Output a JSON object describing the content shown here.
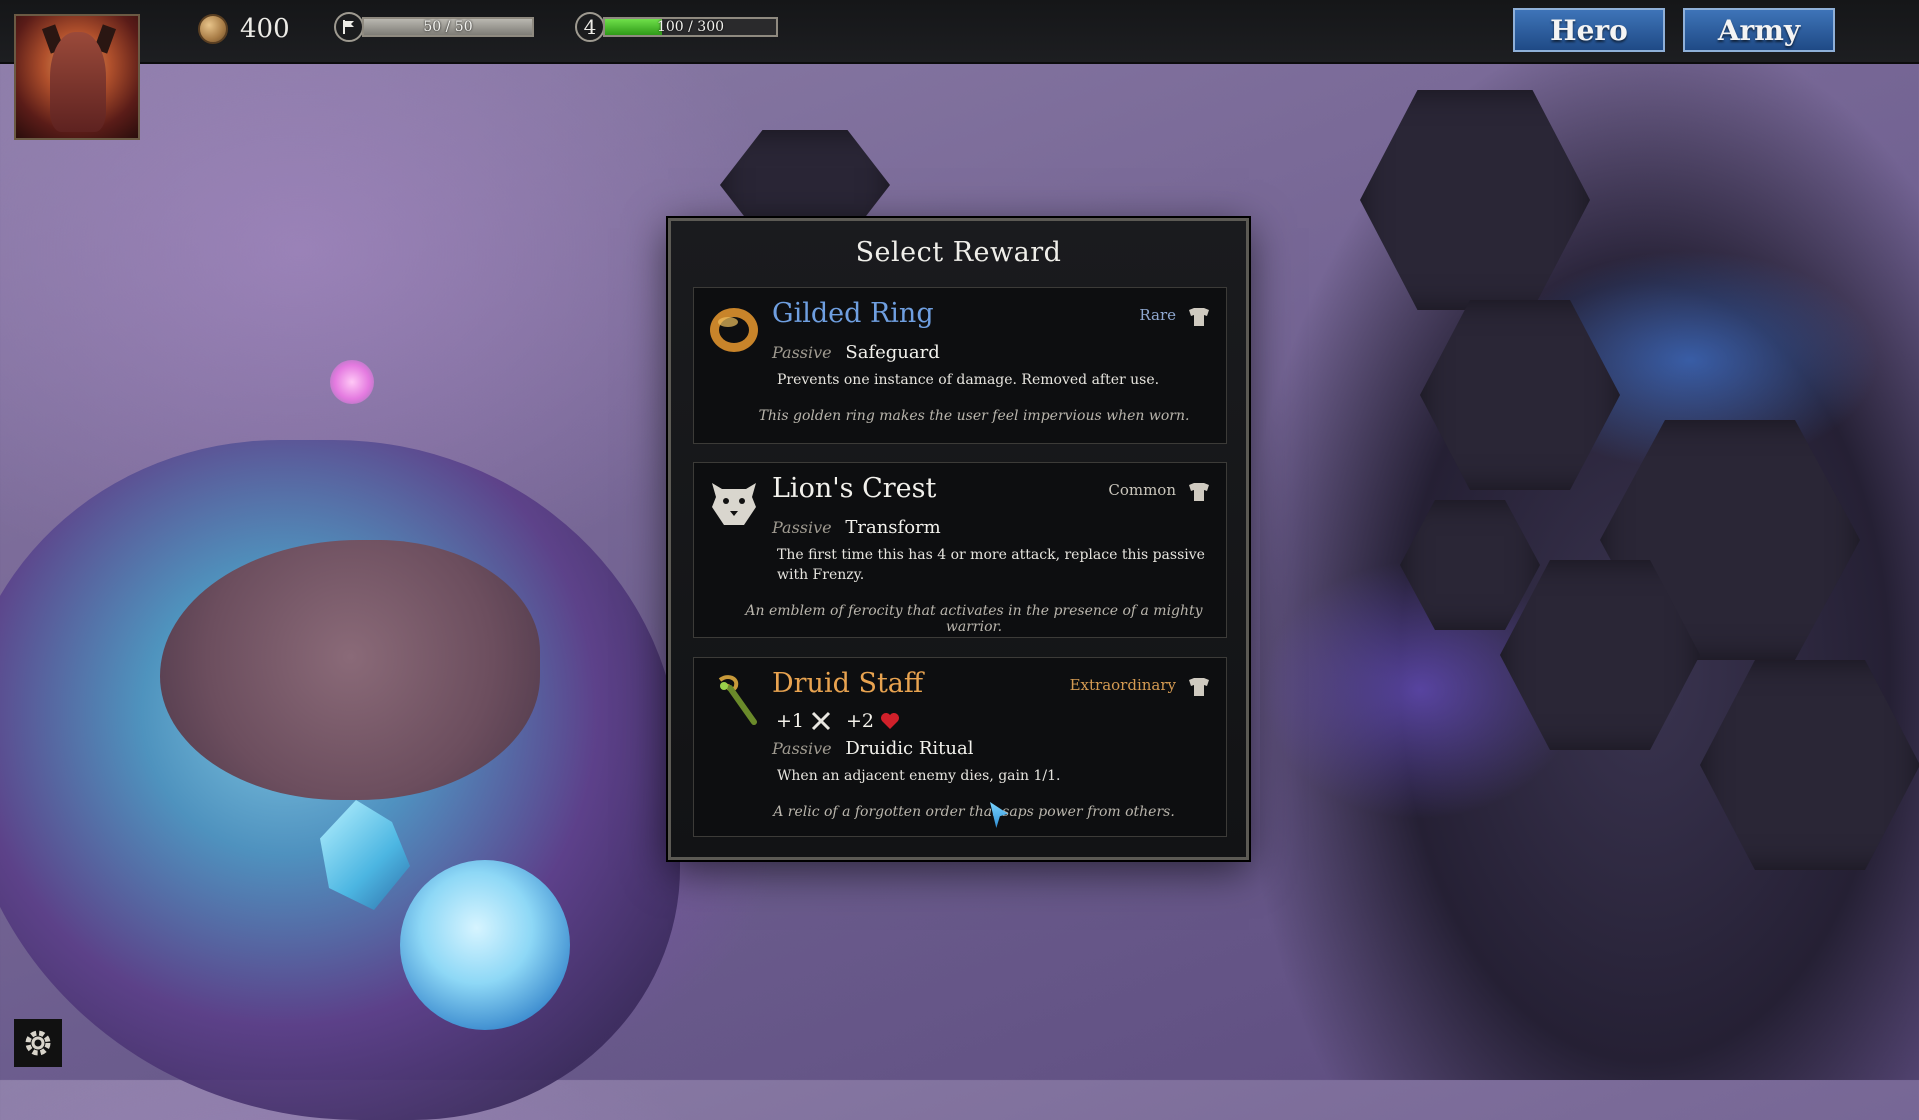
{
  "hud": {
    "gold": "400",
    "flag_bar": {
      "label": "50 / 50",
      "fill": 1.0
    },
    "level": "4",
    "xp_bar": {
      "label": "100 / 300",
      "fill": 0.333
    },
    "buttons": {
      "hero": "Hero",
      "army": "Army"
    }
  },
  "dialog": {
    "title": "Select Reward",
    "rewards": [
      {
        "name": "Gilded Ring",
        "rarity": "Rare",
        "passive_label": "Passive",
        "passive_name": "Safeguard",
        "description": "Prevents one instance of damage. Removed after use.",
        "flavor": "This golden ring makes the user feel impervious when worn.",
        "name_color": "#6f9fe0",
        "rarity_color": "#8fa8d0",
        "icon": "ring-icon"
      },
      {
        "name": "Lion's Crest",
        "rarity": "Common",
        "passive_label": "Passive",
        "passive_name": "Transform",
        "description": "The first time this has 4 or more attack, replace this passive with Frenzy.",
        "flavor": "An emblem of ferocity that activates in the presence of a mighty warrior.",
        "name_color": "#f2f1ec",
        "rarity_color": "#c9c5bb",
        "icon": "lion-crest-icon"
      },
      {
        "name": "Druid Staff",
        "rarity": "Extraordinary",
        "stat_attack": "+1",
        "stat_health": "+2",
        "passive_label": "Passive",
        "passive_name": "Druidic Ritual",
        "description": "When an adjacent enemy dies, gain 1/1.",
        "flavor": "A relic of a forgotten order that saps power from others.",
        "name_color": "#e8a350",
        "rarity_color": "#d49a52",
        "icon": "staff-icon"
      }
    ]
  },
  "colors": {
    "accent_blue": "#2e5fa0",
    "xp_green": "#4cc52a",
    "gold": "#c89a52"
  }
}
